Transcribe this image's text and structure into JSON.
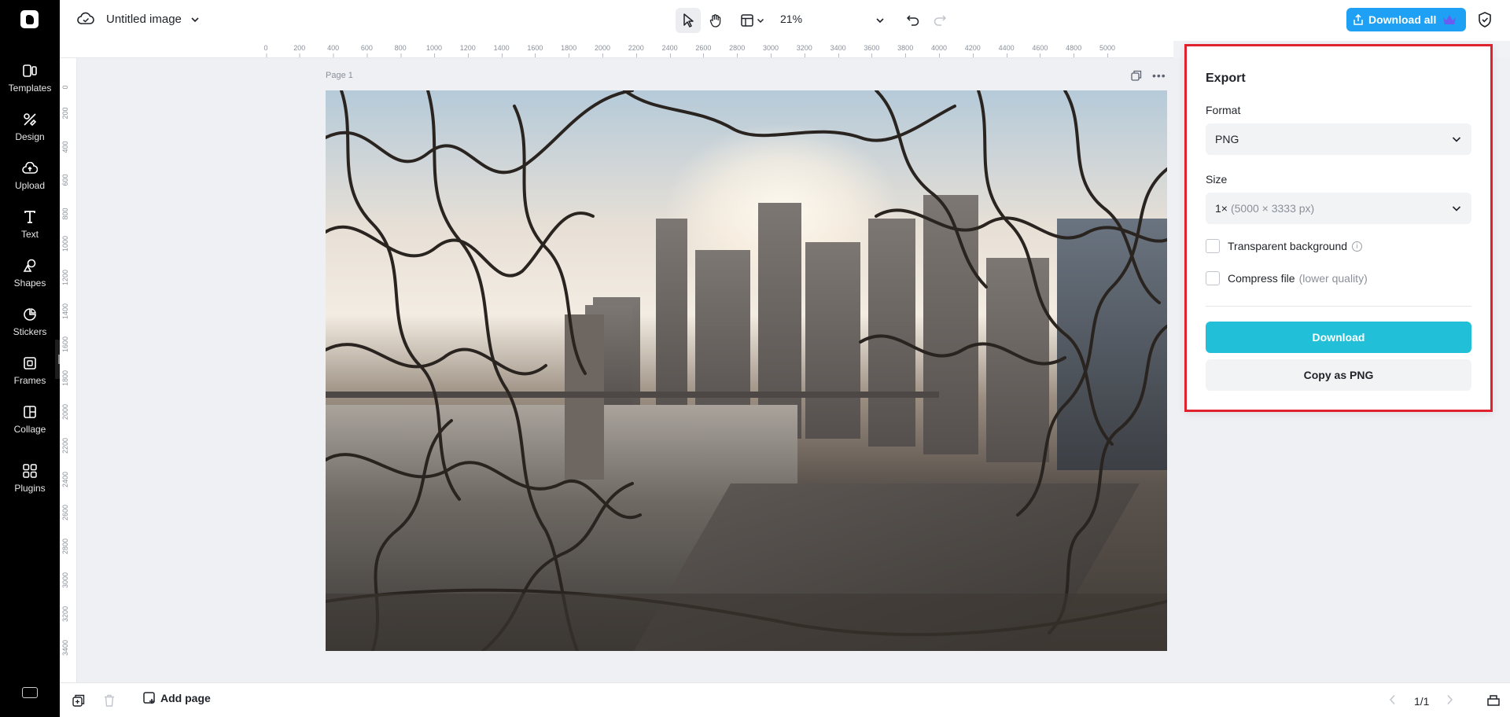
{
  "app": {
    "doc_title": "Untitled image",
    "zoom": "21%",
    "download_all_label": "Download all"
  },
  "sidebar": {
    "items": [
      {
        "label": "Templates",
        "icon": "templates-icon"
      },
      {
        "label": "Design",
        "icon": "design-icon"
      },
      {
        "label": "Upload",
        "icon": "upload-icon"
      },
      {
        "label": "Text",
        "icon": "text-icon"
      },
      {
        "label": "Shapes",
        "icon": "shapes-icon"
      },
      {
        "label": "Stickers",
        "icon": "stickers-icon"
      },
      {
        "label": "Frames",
        "icon": "frames-icon"
      },
      {
        "label": "Collage",
        "icon": "collage-icon"
      },
      {
        "label": "Plugins",
        "icon": "plugins-icon"
      }
    ]
  },
  "ruler": {
    "top_ticks": [
      "0",
      "200",
      "400",
      "600",
      "800",
      "1000",
      "1200",
      "1400",
      "1600",
      "1800",
      "2000",
      "2200",
      "2400",
      "2600",
      "2800",
      "3000",
      "3200",
      "3400",
      "3600",
      "3800",
      "4000",
      "4200",
      "4400",
      "4600",
      "4800",
      "5000"
    ],
    "left_ticks": [
      "0",
      "200",
      "400",
      "600",
      "800",
      "1000",
      "1200",
      "1400",
      "1600",
      "1800",
      "2000",
      "2200",
      "2400",
      "2600",
      "2800",
      "3000",
      "3200",
      "3400"
    ]
  },
  "canvas": {
    "page_label": "Page 1"
  },
  "export": {
    "title": "Export",
    "format_label": "Format",
    "format_value": "PNG",
    "size_label": "Size",
    "size_value": "1×",
    "size_detail": "(5000 × 3333 px)",
    "transparent_label": "Transparent background",
    "transparent_checked": false,
    "compress_label": "Compress file",
    "compress_note": "(lower quality)",
    "compress_checked": false,
    "download_label": "Download",
    "copy_label": "Copy as PNG"
  },
  "bottom": {
    "add_page_label": "Add page",
    "pager": "1/1"
  },
  "colors": {
    "accent": "#22c0d8",
    "download_all_bg": "#1ea1f5",
    "highlight_border": "#e0212e",
    "sidebar_bg": "#000000"
  }
}
